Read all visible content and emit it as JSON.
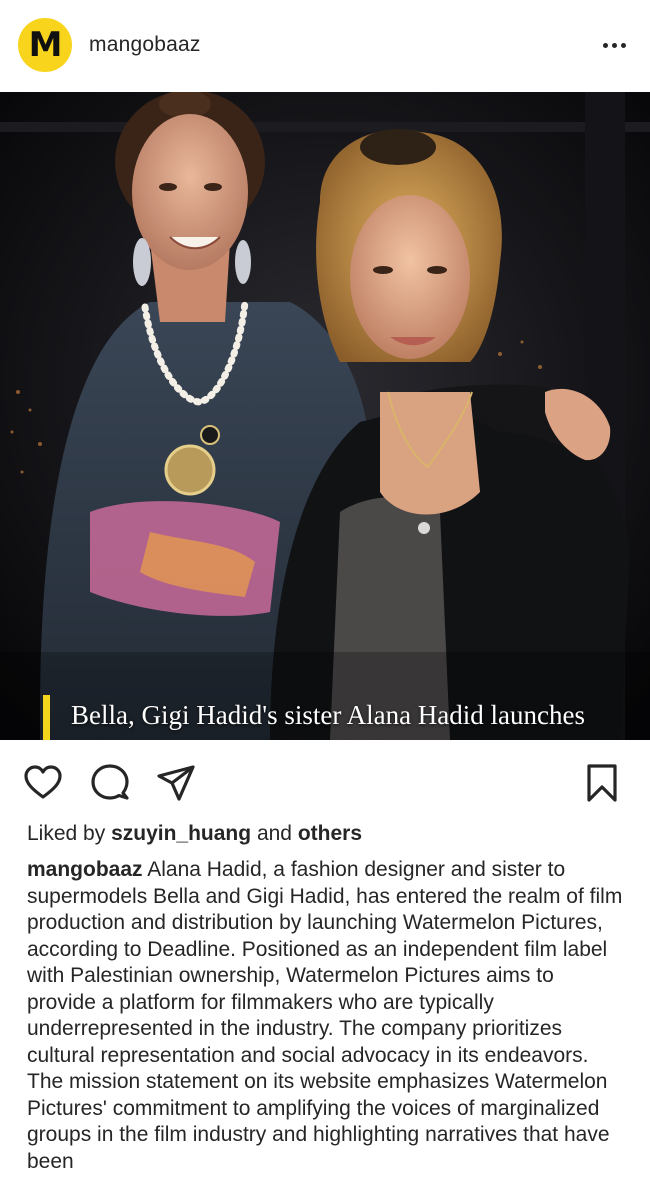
{
  "header": {
    "avatar_letter": "M",
    "username": "mangobaaz",
    "more_icon": "more-horizontal-icon"
  },
  "post": {
    "overlay_title": "Bella, Gigi Hadid's sister Alana Hadid launches Palestinian-owned film label",
    "accent_color": "#f3d51c"
  },
  "actions": {
    "like_icon": "heart-icon",
    "comment_icon": "comment-icon",
    "share_icon": "send-icon",
    "save_icon": "bookmark-icon"
  },
  "likes": {
    "prefix": "Liked by",
    "user": "szuyin_huang",
    "conjunction": "and",
    "others": "others"
  },
  "caption": {
    "user": "mangobaaz",
    "text": "Alana Hadid, a fashion designer and sister to supermodels Bella and Gigi Hadid, has entered the realm of film production and distribution by launching Watermelon Pictures, according to Deadline. Positioned as an independent film label with Palestinian ownership, Watermelon Pictures aims to provide a platform for filmmakers who are typically underrepresented in the industry. The company prioritizes cultural representation and social advocacy in its endeavors. The mission statement on its website emphasizes Watermelon Pictures' commitment to amplifying the voices of marginalized groups in the film industry and highlighting narratives that have been"
  }
}
